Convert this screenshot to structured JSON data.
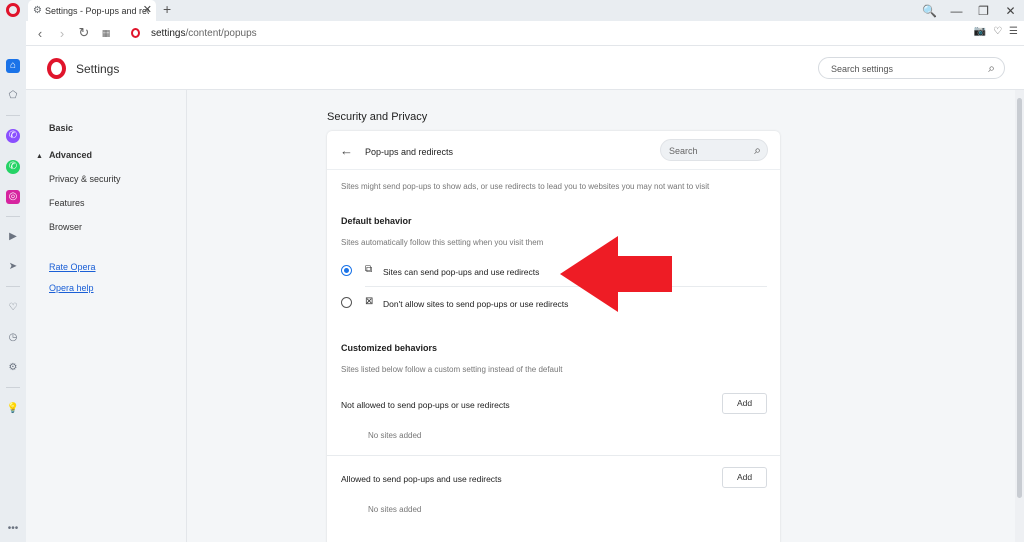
{
  "tab": {
    "title": "Settings - Pop-ups and redirects",
    "close": "✕",
    "new_tab": "+"
  },
  "window_controls": [
    "🔍",
    "—",
    "❐",
    "✕"
  ],
  "address": {
    "host": "settings",
    "path": "/content/popups"
  },
  "header": {
    "title": "Settings",
    "search_placeholder": "Search settings"
  },
  "nav": {
    "basic": "Basic",
    "advanced": "Advanced",
    "items": [
      "Privacy & security",
      "Features",
      "Browser"
    ],
    "links": [
      "Rate Opera",
      "Opera help"
    ]
  },
  "main": {
    "section_title": "Security and Privacy",
    "card": {
      "title": "Pop-ups and redirects",
      "search_placeholder": "Search",
      "description": "Sites might send pop-ups to show ads, or use redirects to lead you to websites you may not want to visit",
      "default_behavior": {
        "heading": "Default behavior",
        "subtext": "Sites automatically follow this setting when you visit them",
        "options": [
          {
            "label": "Sites can send pop-ups and use redirects",
            "checked": true
          },
          {
            "label": "Don't allow sites to send pop-ups or use redirects",
            "checked": false
          }
        ]
      },
      "customized": {
        "heading": "Customized behaviors",
        "subtext": "Sites listed below follow a custom setting instead of the default",
        "not_allowed": {
          "label": "Not allowed to send pop-ups or use redirects",
          "button": "Add",
          "empty": "No sites added"
        },
        "allowed": {
          "label": "Allowed to send pop-ups and use redirects",
          "button": "Add",
          "empty": "No sites added"
        }
      }
    }
  },
  "colors": {
    "opera_red": "#e0142b",
    "accent_blue": "#1a73e8",
    "annotation_red": "#ee1c25"
  }
}
